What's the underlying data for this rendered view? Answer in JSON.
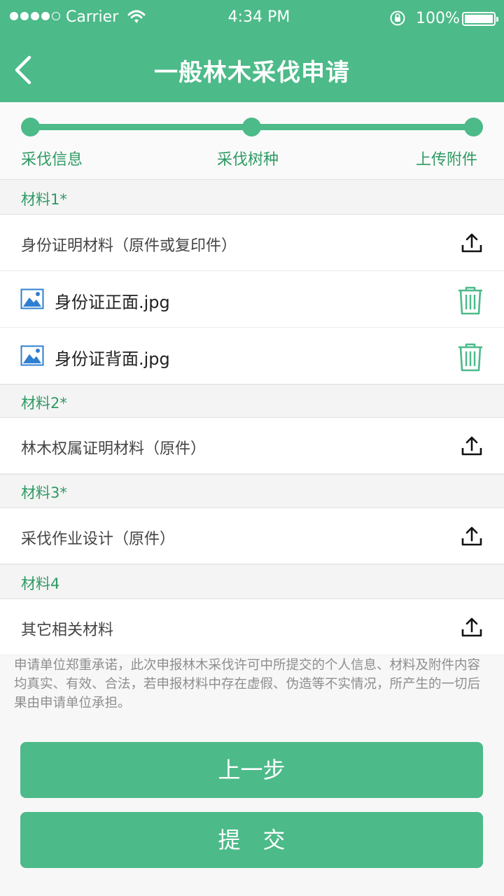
{
  "status_bar": {
    "carrier": "Carrier",
    "time": "4:34 PM",
    "battery": "100%",
    "icons": [
      "signal-dots-icon",
      "wifi-icon",
      "rotation-lock-icon",
      "battery-icon"
    ]
  },
  "header": {
    "title": "一般林木采伐申请",
    "back_icon": "chevron-left-icon"
  },
  "stepper": {
    "steps": [
      "采伐信息",
      "采伐树种",
      "上传附件"
    ]
  },
  "materials": [
    {
      "section": "材料1*",
      "item": "身份证明材料（原件或复印件）",
      "files": [
        "身份证正面.jpg",
        "身份证背面.jpg"
      ]
    },
    {
      "section": "材料2*",
      "item": "林木权属证明材料（原件）"
    },
    {
      "section": "材料3*",
      "item": "采伐作业设计（原件）"
    },
    {
      "section": "材料4",
      "item": "其它相关材料"
    }
  ],
  "notice": "申请单位郑重承诺，此次申报林木采伐许可中所提交的个人信息、材料及附件内容均真实、有效、合法，若申报材料中存在虚假、伪造等不实情况，所产生的一切后果由申请单位承担。",
  "buttons": {
    "prev": "上一步",
    "submit": "提　交"
  },
  "colors": {
    "brand": "#4cba89",
    "section_text": "#2e9a63",
    "notice_text": "#8e8e8e"
  }
}
